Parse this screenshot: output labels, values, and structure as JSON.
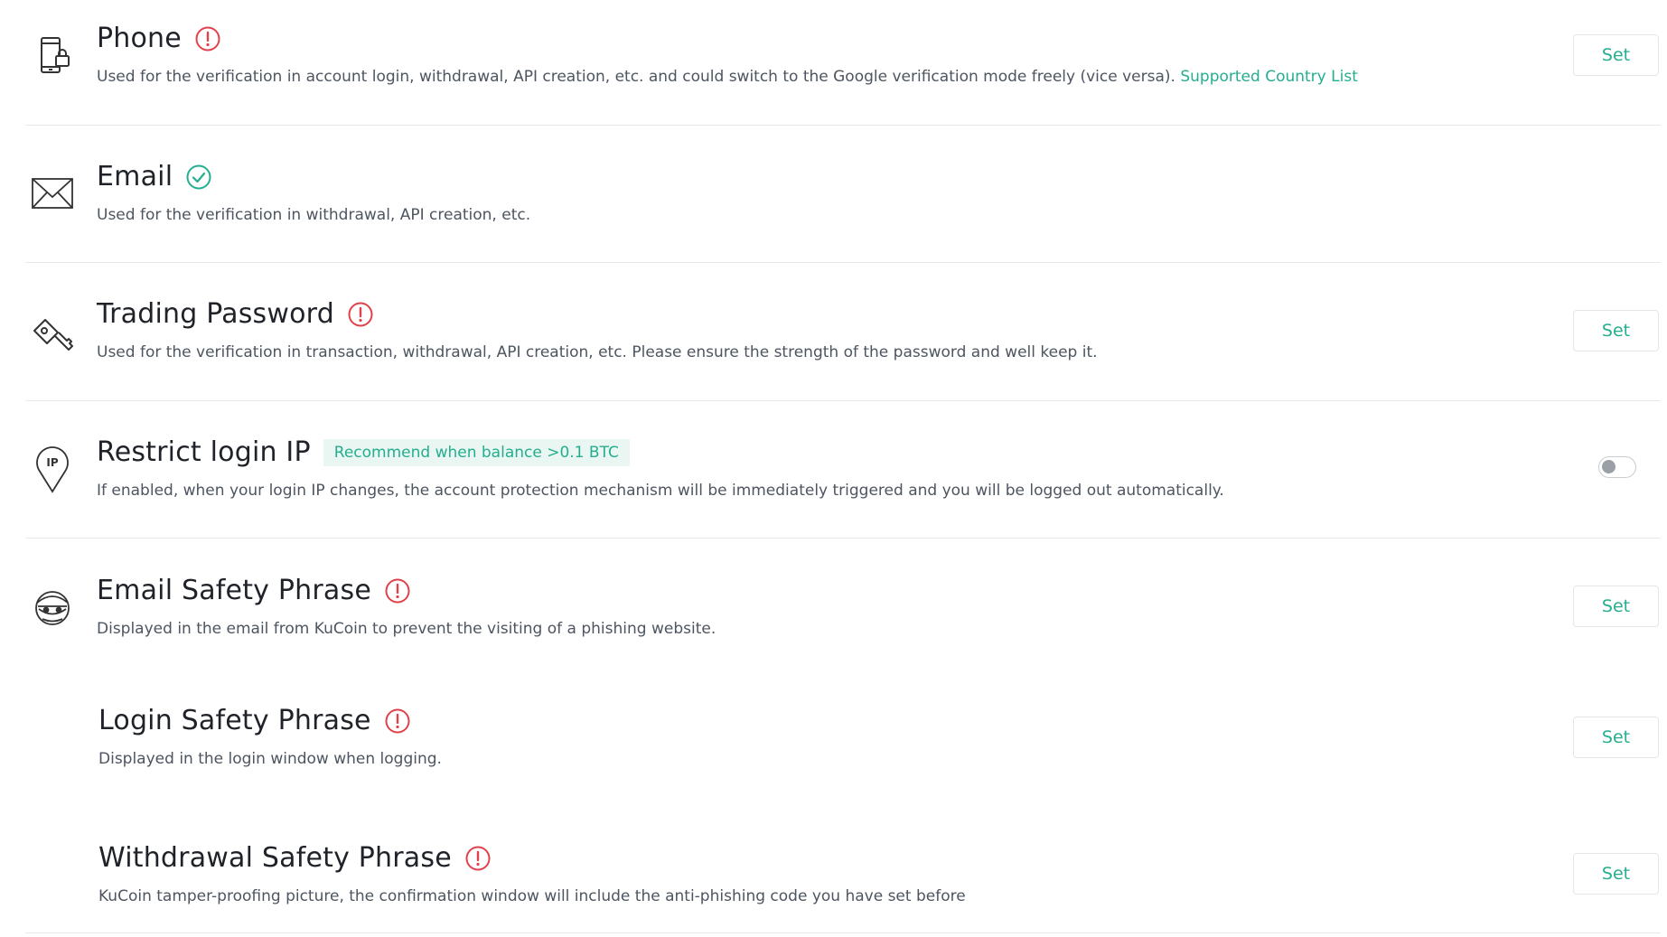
{
  "colors": {
    "accent": "#24ae8f",
    "warning": "#e0424b",
    "divider": "#e6e8eb",
    "text": "#1f2329",
    "muted": "#4d5560"
  },
  "items": {
    "phone": {
      "icon": "phone-lock-icon",
      "title": "Phone",
      "status": "warning",
      "description": "Used for the verification in account login, withdrawal, API creation, etc. and could switch to the Google verification mode freely (vice versa).",
      "link": "Supported Country List",
      "action": "Set"
    },
    "email": {
      "icon": "envelope-icon",
      "title": "Email",
      "status": "verified",
      "description": "Used for the verification in withdrawal, API creation, etc."
    },
    "trading_password": {
      "icon": "key-icon",
      "title": "Trading Password",
      "status": "warning",
      "description": "Used for the verification in transaction, withdrawal, API creation, etc. Please ensure the strength of the password and well keep it.",
      "action": "Set"
    },
    "restrict_ip": {
      "icon": "ip-location-pin-icon",
      "title": "Restrict login IP",
      "tag": "Recommend when balance >0.1 BTC",
      "description": "If enabled, when your login IP changes, the account protection mechanism will be immediately triggered and you will be logged out automatically.",
      "toggle_on": false
    },
    "email_safety_phrase": {
      "icon": "masked-thief-icon",
      "title": "Email Safety Phrase",
      "status": "warning",
      "description": "Displayed in the email from KuCoin to prevent the visiting of a phishing website.",
      "action": "Set"
    },
    "login_safety_phrase": {
      "title": "Login Safety Phrase",
      "status": "warning",
      "description": "Displayed in the login window when logging.",
      "action": "Set"
    },
    "withdrawal_safety_phrase": {
      "title": "Withdrawal Safety Phrase",
      "status": "warning",
      "description": "KuCoin tamper-proofing picture, the confirmation window will include the anti-phishing code you have set before",
      "action": "Set"
    }
  }
}
